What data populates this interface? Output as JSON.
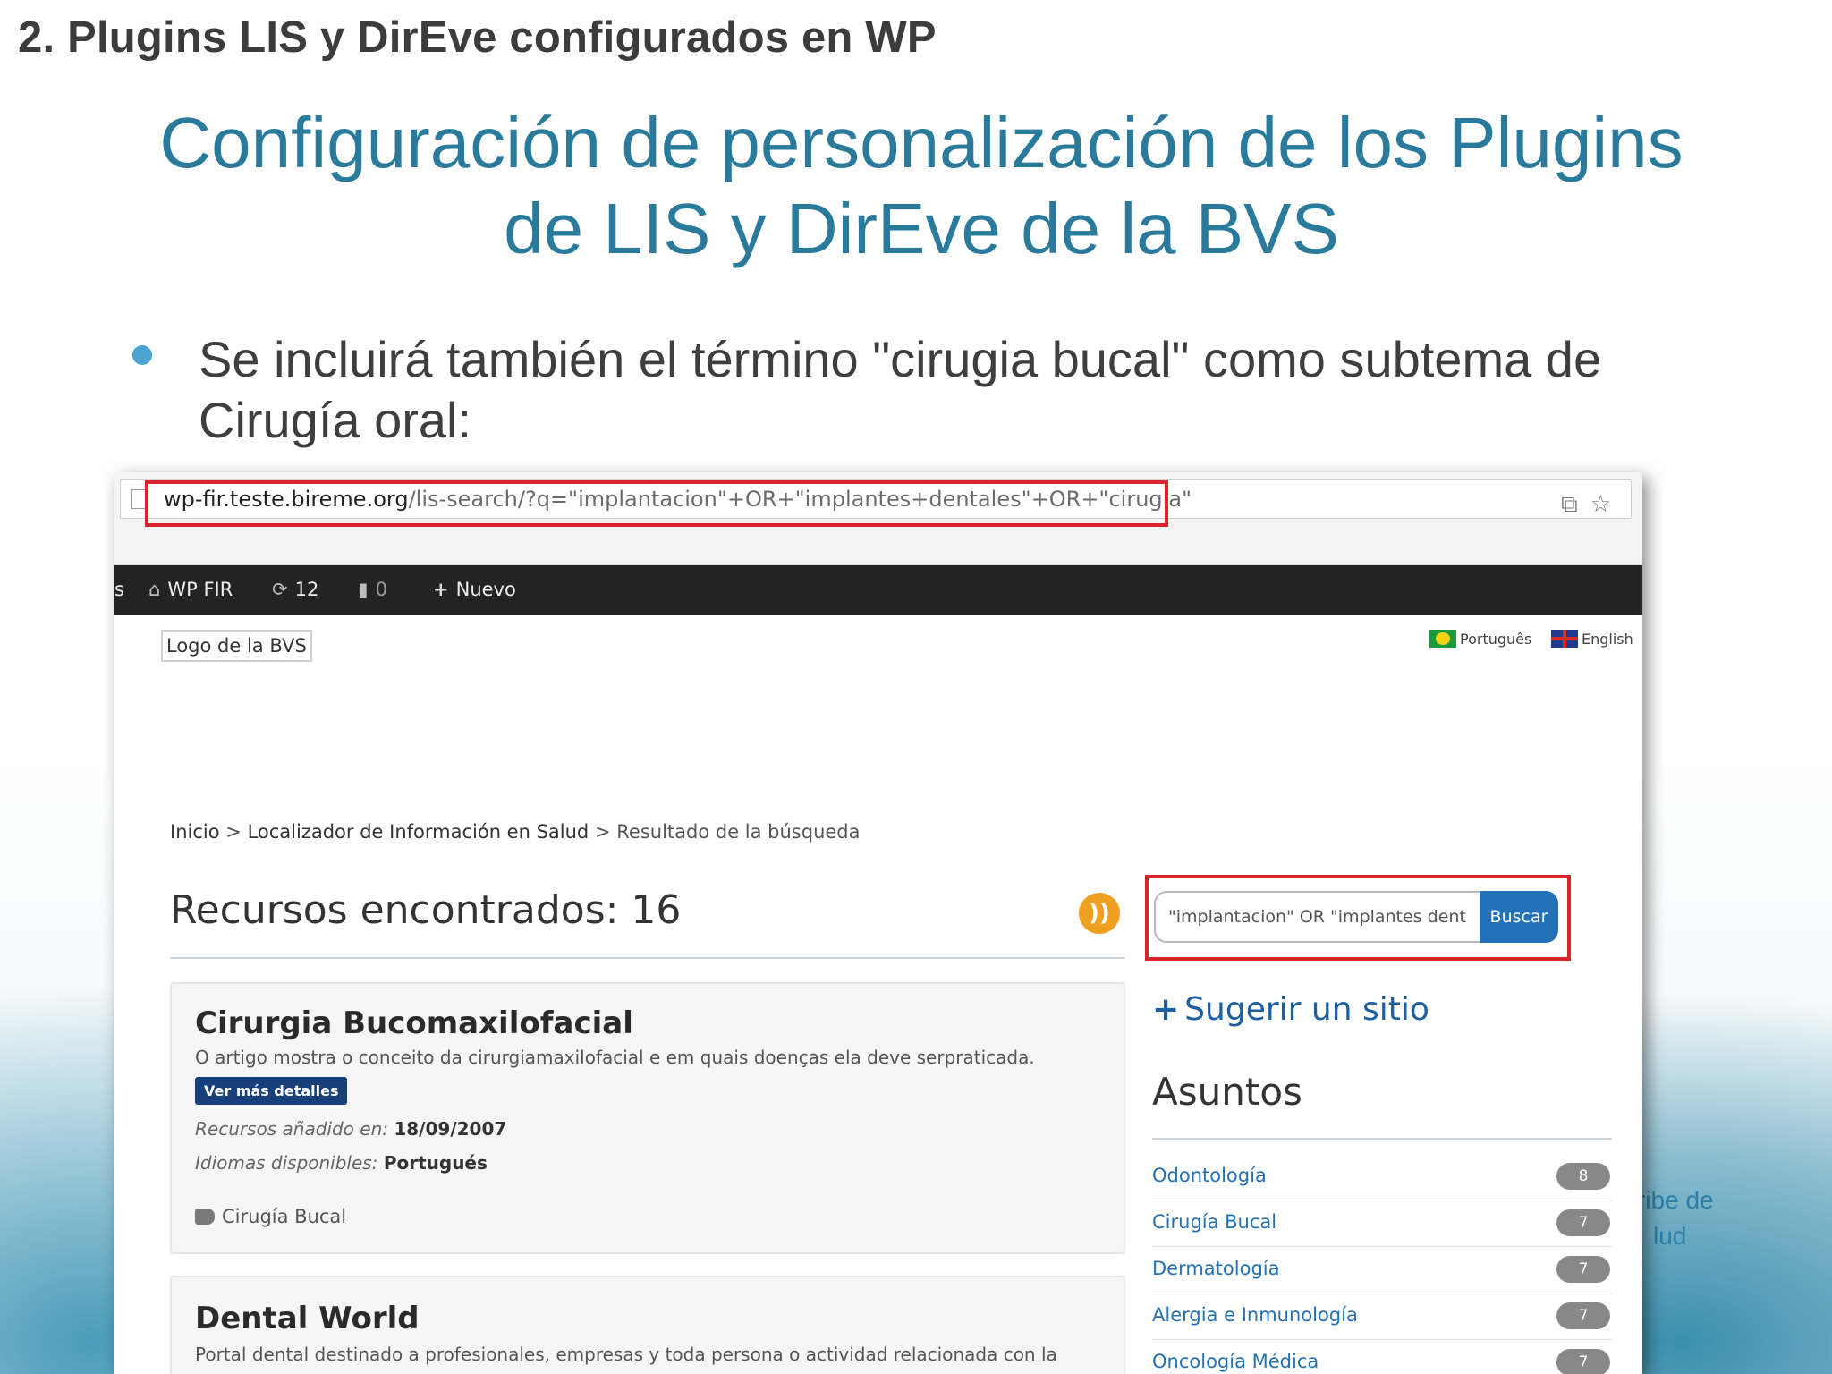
{
  "slide": {
    "section_title": "2. Plugins LIS y DirEve configurados en WP",
    "title_line1": "Configuración de personalización de los Plugins",
    "title_line2": "de LIS y DirEve de la BVS",
    "bullet_line1": "Se incluirá también el término \"cirugia bucal\" como subtema de",
    "bullet_line2": "Cirugía oral:",
    "footer_fragment_line1": "ribe de",
    "footer_fragment_line2": "lud"
  },
  "browser": {
    "url_host": "wp-fir.teste.bireme.org",
    "url_path": "/lis-search/?q=\"implantacion\"+OR+\"implantes+dentales\"+OR+\"cirugia\"",
    "icons": [
      "translate-icon",
      "star-icon"
    ]
  },
  "admin_bar": {
    "cut_text": "s",
    "site_name": "WP FIR",
    "updates_count": "12",
    "comments_count": "0",
    "new_label": "Nuevo"
  },
  "header": {
    "logo_text": "Logo de la BVS",
    "lang_pt": "Português",
    "lang_en": "English"
  },
  "breadcrumb": {
    "home": "Inicio",
    "sep1": ">",
    "section": "Localizador de Información en Salud",
    "sep2": ">",
    "current": "Resultado de la búsqueda"
  },
  "results": {
    "title": "Recursos encontrados: 16",
    "search_value": "\"implantacion\" OR \"implantes dent",
    "search_button": "Buscar"
  },
  "cards": [
    {
      "title": "Cirurgia Bucomaxilofacial",
      "description": "O artigo mostra o conceito da cirurgiamaxilofacial e em quais doenças ela deve serpraticada.",
      "details_label": "Ver más detalles",
      "added_label": "Recursos añadido en:",
      "added_value": "18/09/2007",
      "languages_label": "Idiomas disponibles:",
      "languages_value": "Portugués",
      "tag": "Cirugía Bucal"
    },
    {
      "title": "Dental World",
      "description": "Portal dental destinado a profesionales, empresas y toda persona o actividad relacionada con la"
    }
  ],
  "sidebar": {
    "suggest_label": "Sugerir un sitio",
    "subjects_title": "Asuntos",
    "subjects": [
      {
        "label": "Odontología",
        "count": "8"
      },
      {
        "label": "Cirugía Bucal",
        "count": "7"
      },
      {
        "label": "Dermatología",
        "count": "7"
      },
      {
        "label": "Alergia e Inmunología",
        "count": "7"
      },
      {
        "label": "Oncología Médica",
        "count": "7"
      }
    ]
  },
  "colors": {
    "slide_title": "#2a7a9c",
    "highlight_red": "#d9232e",
    "button_blue": "#2372b8",
    "admin_bar": "#232323",
    "rss_orange": "#f0a020"
  }
}
